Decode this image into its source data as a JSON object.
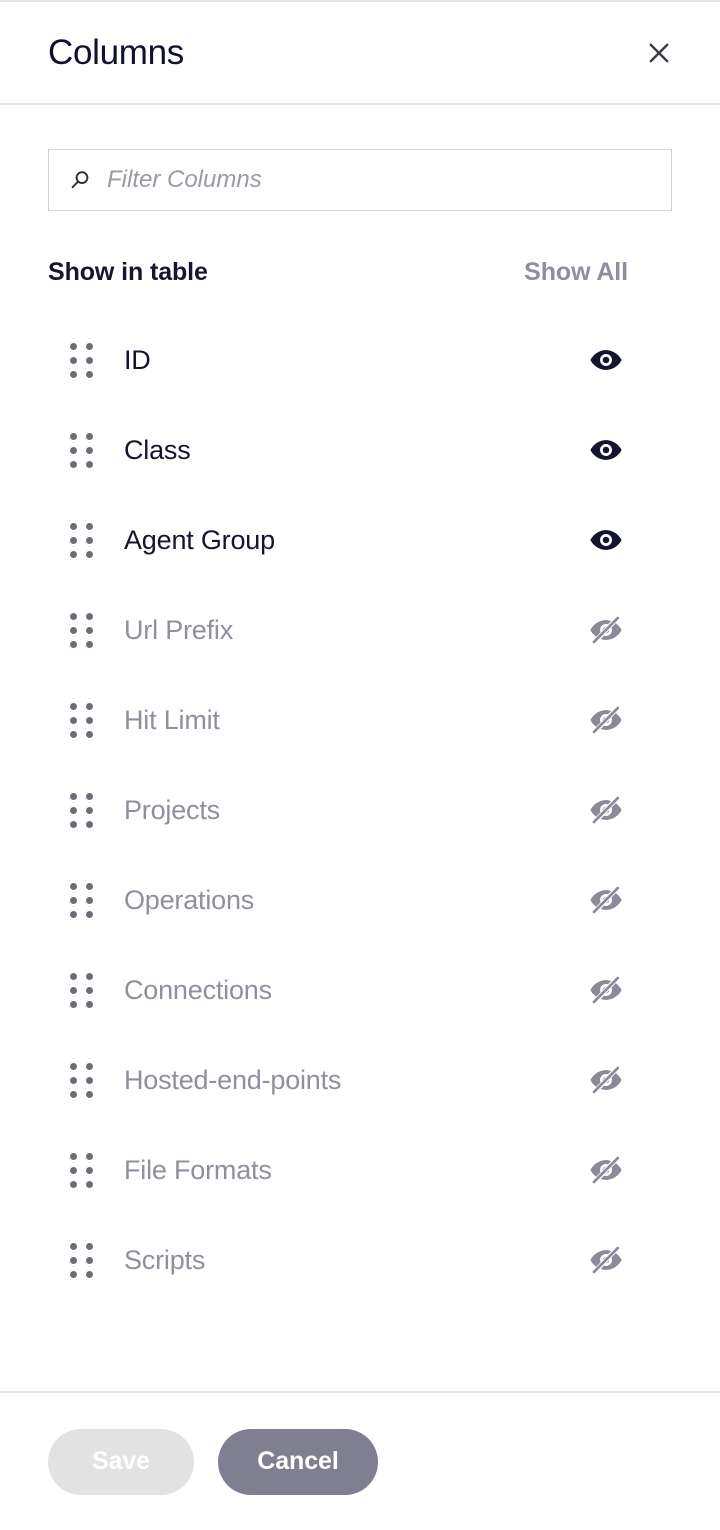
{
  "dialog": {
    "title": "Columns",
    "close_icon": "close-icon"
  },
  "search": {
    "icon": "search-icon",
    "placeholder": "Filter Columns",
    "value": ""
  },
  "section": {
    "title": "Show in table",
    "show_all_label": "Show All"
  },
  "columns": [
    {
      "label": "ID",
      "visible": true,
      "icon": "eye-icon"
    },
    {
      "label": "Class",
      "visible": true,
      "icon": "eye-icon"
    },
    {
      "label": "Agent Group",
      "visible": true,
      "icon": "eye-icon"
    },
    {
      "label": "Url Prefix",
      "visible": false,
      "icon": "eye-off-icon"
    },
    {
      "label": "Hit Limit",
      "visible": false,
      "icon": "eye-off-icon"
    },
    {
      "label": "Projects",
      "visible": false,
      "icon": "eye-off-icon"
    },
    {
      "label": "Operations",
      "visible": false,
      "icon": "eye-off-icon"
    },
    {
      "label": "Connections",
      "visible": false,
      "icon": "eye-off-icon"
    },
    {
      "label": "Hosted-end-points",
      "visible": false,
      "icon": "eye-off-icon"
    },
    {
      "label": "File Formats",
      "visible": false,
      "icon": "eye-off-icon"
    },
    {
      "label": "Scripts",
      "visible": false,
      "icon": "eye-off-icon"
    }
  ],
  "footer": {
    "save_label": "Save",
    "save_disabled": true,
    "cancel_label": "Cancel"
  },
  "colors": {
    "title_text": "#10102e",
    "visible_text": "#14142e",
    "hidden_text": "#90909d",
    "muted": "#8e8e9e",
    "divider": "#e6e6ec",
    "eye_on": "#14142e",
    "eye_off": "#8a8a98",
    "save_bg": "#e2e2e2",
    "cancel_bg": "#7f7f91"
  }
}
